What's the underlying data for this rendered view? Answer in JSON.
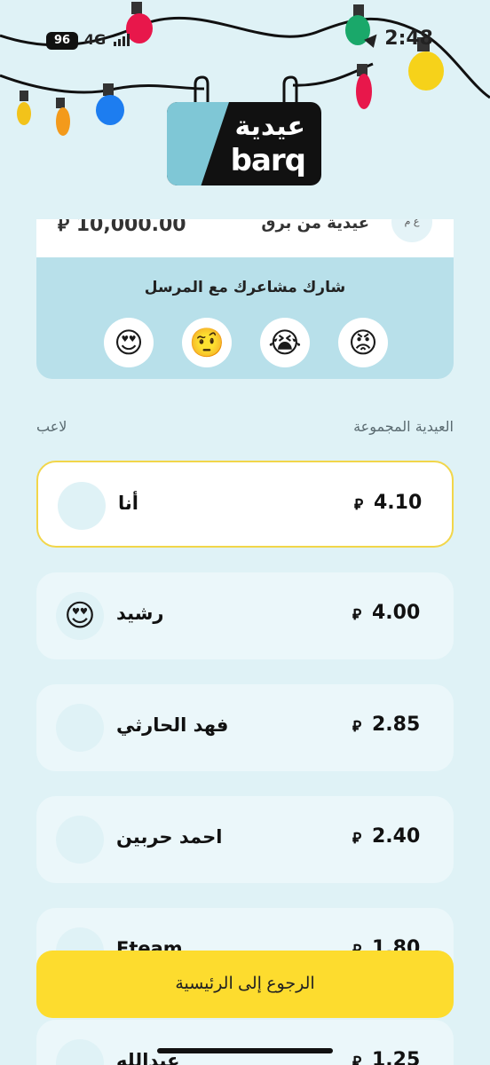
{
  "status_bar": {
    "battery": "96",
    "network": "4G",
    "time": "2:48"
  },
  "logo": {
    "arabic": "عيدية",
    "latin": "barq"
  },
  "gift_card": {
    "amount": "10,000.00",
    "currency": "⃁",
    "title": "عيدية من برق",
    "avatar_initials": "ع م"
  },
  "feelings": {
    "title": "شارك مشاعرك مع المرسل",
    "options": [
      {
        "emoji": "😍",
        "name": "heart-eyes"
      },
      {
        "emoji": "🤨",
        "name": "raised-eyebrow"
      },
      {
        "emoji": "😭",
        "name": "crying"
      },
      {
        "emoji": "😡",
        "name": "angry"
      }
    ]
  },
  "list_header": {
    "collected": "العيدية المجموعة",
    "player": "لاعب"
  },
  "players": [
    {
      "name": "أنا",
      "amount": "4.10",
      "currency": "⃁",
      "emoji": "",
      "highlight": true
    },
    {
      "name": "رشيد",
      "amount": "4.00",
      "currency": "⃁",
      "emoji": "😍",
      "highlight": false
    },
    {
      "name": "فهد الحارثي",
      "amount": "2.85",
      "currency": "⃁",
      "emoji": "",
      "highlight": false
    },
    {
      "name": "احمد حربين",
      "amount": "2.40",
      "currency": "⃁",
      "emoji": "",
      "highlight": false
    },
    {
      "name": "Fteam",
      "amount": "1.80",
      "currency": "⃁",
      "emoji": "",
      "highlight": false
    },
    {
      "name": "عبدالله",
      "amount": "1.25",
      "currency": "⃁",
      "emoji": "",
      "highlight": false
    }
  ],
  "home_button": {
    "label": "الرجوع إلى الرئيسية"
  },
  "colors": {
    "background": "#dff2f6",
    "accent_yellow": "#fddc2e",
    "highlight_border": "#f2d64a"
  }
}
